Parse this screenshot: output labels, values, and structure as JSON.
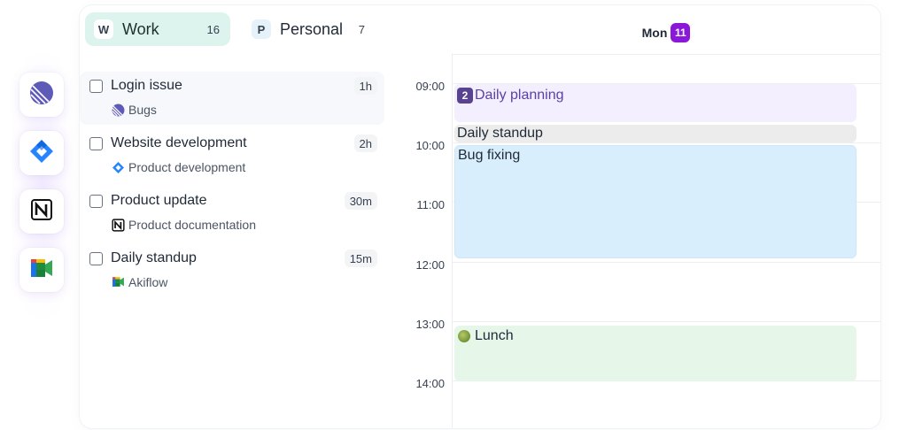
{
  "integrations": [
    {
      "icon": "linear-icon"
    },
    {
      "icon": "jira-icon"
    },
    {
      "icon": "notion-icon"
    },
    {
      "icon": "google-meet-icon"
    }
  ],
  "tabs": [
    {
      "letter": "W",
      "label": "Work",
      "count": "16"
    },
    {
      "letter": "P",
      "label": "Personal",
      "count": "7"
    }
  ],
  "tasks": [
    {
      "title": "Login issue",
      "source": "Bugs",
      "source_icon": "linear-icon",
      "duration": "1h"
    },
    {
      "title": "Website development",
      "source": "Product development",
      "source_icon": "jira-icon",
      "duration": "2h"
    },
    {
      "title": "Product update",
      "source": "Product documentation",
      "source_icon": "notion-icon",
      "duration": "30m"
    },
    {
      "title": "Daily standup",
      "source": "Akiflow",
      "source_icon": "google-meet-icon",
      "duration": "15m"
    }
  ],
  "calendar": {
    "day_name": "Mon",
    "day_number": "11",
    "hours": [
      "09:00",
      "10:00",
      "11:00",
      "12:00",
      "13:00",
      "14:00"
    ],
    "events": {
      "planning": {
        "badge": "2",
        "title": "Daily planning"
      },
      "standup": {
        "title": "Daily standup"
      },
      "bug": {
        "title": "Bug fixing"
      },
      "lunch": {
        "title": "Lunch"
      }
    }
  },
  "colors": {
    "accent": "#8b18d8",
    "work_tab_bg": "#dcf3ee",
    "planning_bg": "#f3efff",
    "bug_bg": "#d9eefc",
    "lunch_bg": "#e6f7ea",
    "standup_bg": "#ececec"
  }
}
